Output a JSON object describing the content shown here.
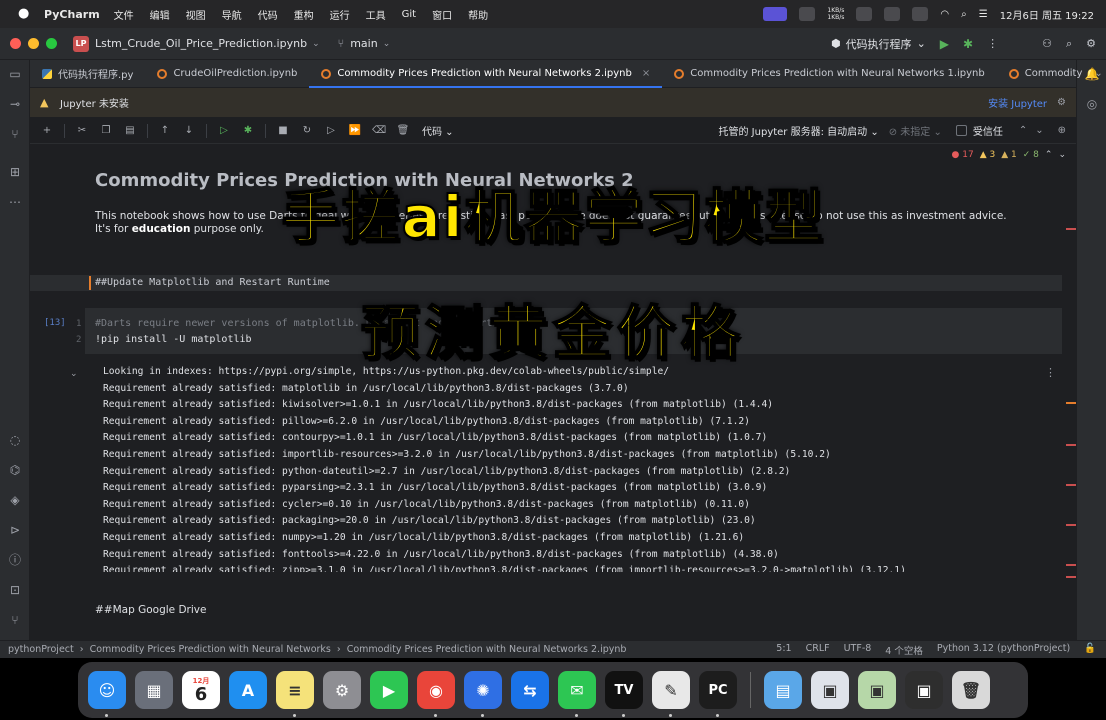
{
  "menubar": {
    "app_name": "PyCharm",
    "menus": [
      "文件",
      "编辑",
      "视图",
      "导航",
      "代码",
      "重构",
      "运行",
      "工具",
      "Git",
      "窗口",
      "帮助"
    ],
    "net_up": "1KB/s",
    "net_down": "1KB/s",
    "datetime": "12月6日 周五 19:22"
  },
  "titlebar": {
    "project_badge": "LP",
    "project_name": "Lstm_Crude_Oil_Price_Prediction.ipynb",
    "branch": "main",
    "run_config": "代码执行程序"
  },
  "tabs": [
    {
      "label": "代码执行程序.py",
      "kind": "py"
    },
    {
      "label": "CrudeOilPrediction.ipynb",
      "kind": "nb"
    },
    {
      "label": "Commodity Prices Prediction with Neural Networks 2.ipynb",
      "kind": "nb",
      "active": true
    },
    {
      "label": "Commodity Prices Prediction with Neural Networks 1.ipynb",
      "kind": "nb"
    },
    {
      "label": "Commodity",
      "kind": "nb"
    }
  ],
  "banner": {
    "message": "Jupyter 未安装",
    "action": "安装 Jupyter"
  },
  "nbtoolbar": {
    "cell_type": "代码",
    "server": "托管的 Jupyter 服务器: 自动启动",
    "interpreter": "未指定",
    "trusted": "受信任"
  },
  "inspections": {
    "errors": "17",
    "warnings": "3",
    "weak": "1",
    "ok": "8"
  },
  "notebook": {
    "title": "Commodity Prices Prediction with Neural Networks 2",
    "intro_before": "This notebook shows how to use Darts to deal with time series forecasting. Past performance does not guarantee future results. Please do not use this as investment advice. It's for ",
    "intro_bold": "education",
    "intro_after": " purpose only.",
    "md_heading": "##Update Matplotlib and Restart Runtime",
    "exec_count": "[13]",
    "code_lines": [
      {
        "num": "1",
        "text": "#Darts require newer versions of matplotlib. Update it and restart runtime.",
        "comment": true
      },
      {
        "num": "2",
        "text": "!pip install -U matplotlib",
        "comment": false
      }
    ],
    "output": [
      "Looking in indexes: https://pypi.org/simple, https://us-python.pkg.dev/colab-wheels/public/simple/",
      "Requirement already satisfied: matplotlib in /usr/local/lib/python3.8/dist-packages (3.7.0)",
      "Requirement already satisfied: kiwisolver>=1.0.1 in /usr/local/lib/python3.8/dist-packages (from matplotlib) (1.4.4)",
      "Requirement already satisfied: pillow>=6.2.0 in /usr/local/lib/python3.8/dist-packages (from matplotlib) (7.1.2)",
      "Requirement already satisfied: contourpy>=1.0.1 in /usr/local/lib/python3.8/dist-packages (from matplotlib) (1.0.7)",
      "Requirement already satisfied: importlib-resources>=3.2.0 in /usr/local/lib/python3.8/dist-packages (from matplotlib) (5.10.2)",
      "Requirement already satisfied: python-dateutil>=2.7 in /usr/local/lib/python3.8/dist-packages (from matplotlib) (2.8.2)",
      "Requirement already satisfied: pyparsing>=2.3.1 in /usr/local/lib/python3.8/dist-packages (from matplotlib) (3.0.9)",
      "Requirement already satisfied: cycler>=0.10 in /usr/local/lib/python3.8/dist-packages (from matplotlib) (0.11.0)",
      "Requirement already satisfied: packaging>=20.0 in /usr/local/lib/python3.8/dist-packages (from matplotlib) (23.0)",
      "Requirement already satisfied: numpy>=1.20 in /usr/local/lib/python3.8/dist-packages (from matplotlib) (1.21.6)",
      "Requirement already satisfied: fonttools>=4.22.0 in /usr/local/lib/python3.8/dist-packages (from matplotlib) (4.38.0)",
      "Requirement already satisfied: zipp>=3.1.0 in /usr/local/lib/python3.8/dist-packages (from importlib-resources>=3.2.0->matplotlib) (3.12.1)"
    ],
    "md_heading_2": "##Map Google Drive"
  },
  "overlay": {
    "line1": "手搓ai机器学习模型",
    "line2": "预测黄金价格"
  },
  "statusbar": {
    "crumbs": [
      "pythonProject",
      "Commodity Prices Prediction with Neural Networks",
      "Commodity Prices Prediction with Neural Networks 2.ipynb"
    ],
    "position": "5:1",
    "line_sep": "CRLF",
    "encoding": "UTF-8",
    "indent": "4 个空格",
    "interpreter": "Python 3.12 (pythonProject)"
  },
  "dock": {
    "calendar_month": "12月",
    "calendar_day": "6",
    "apps": [
      {
        "name": "finder",
        "color": "#2a8cf0",
        "glyph": "☺"
      },
      {
        "name": "launchpad",
        "color": "#6a6f7a",
        "glyph": "▦"
      },
      {
        "name": "calendar",
        "color": "#ffffff",
        "glyph": ""
      },
      {
        "name": "app-store",
        "color": "#1f8ff0",
        "glyph": "A"
      },
      {
        "name": "notes",
        "color": "#f5e27a",
        "glyph": "≡"
      },
      {
        "name": "settings",
        "color": "#8e8e93",
        "glyph": "⚙"
      },
      {
        "name": "facetime",
        "color": "#2dc653",
        "glyph": "▶"
      },
      {
        "name": "chrome",
        "color": "#e9453a",
        "glyph": "◉"
      },
      {
        "name": "astro",
        "color": "#2f6fe4",
        "glyph": "✺"
      },
      {
        "name": "teamviewer",
        "color": "#1a73e8",
        "glyph": "⇆"
      },
      {
        "name": "wechat",
        "color": "#2dc653",
        "glyph": "✉"
      },
      {
        "name": "tradingview",
        "color": "#111111",
        "glyph": "TV"
      },
      {
        "name": "textedit",
        "color": "#e8e8e8",
        "glyph": "✎"
      },
      {
        "name": "pycharm",
        "color": "#1d1d1d",
        "glyph": "PC"
      },
      {
        "name": "downloads",
        "color": "#5aa7e8",
        "glyph": "▤"
      },
      {
        "name": "screens-1",
        "color": "#dfe3ea",
        "glyph": "▣"
      },
      {
        "name": "screens-2",
        "color": "#b6d7a8",
        "glyph": "▣"
      },
      {
        "name": "screens-3",
        "color": "#2e2e2e",
        "glyph": "▣"
      },
      {
        "name": "trash",
        "color": "#d9d9d9",
        "glyph": "🗑"
      }
    ]
  }
}
